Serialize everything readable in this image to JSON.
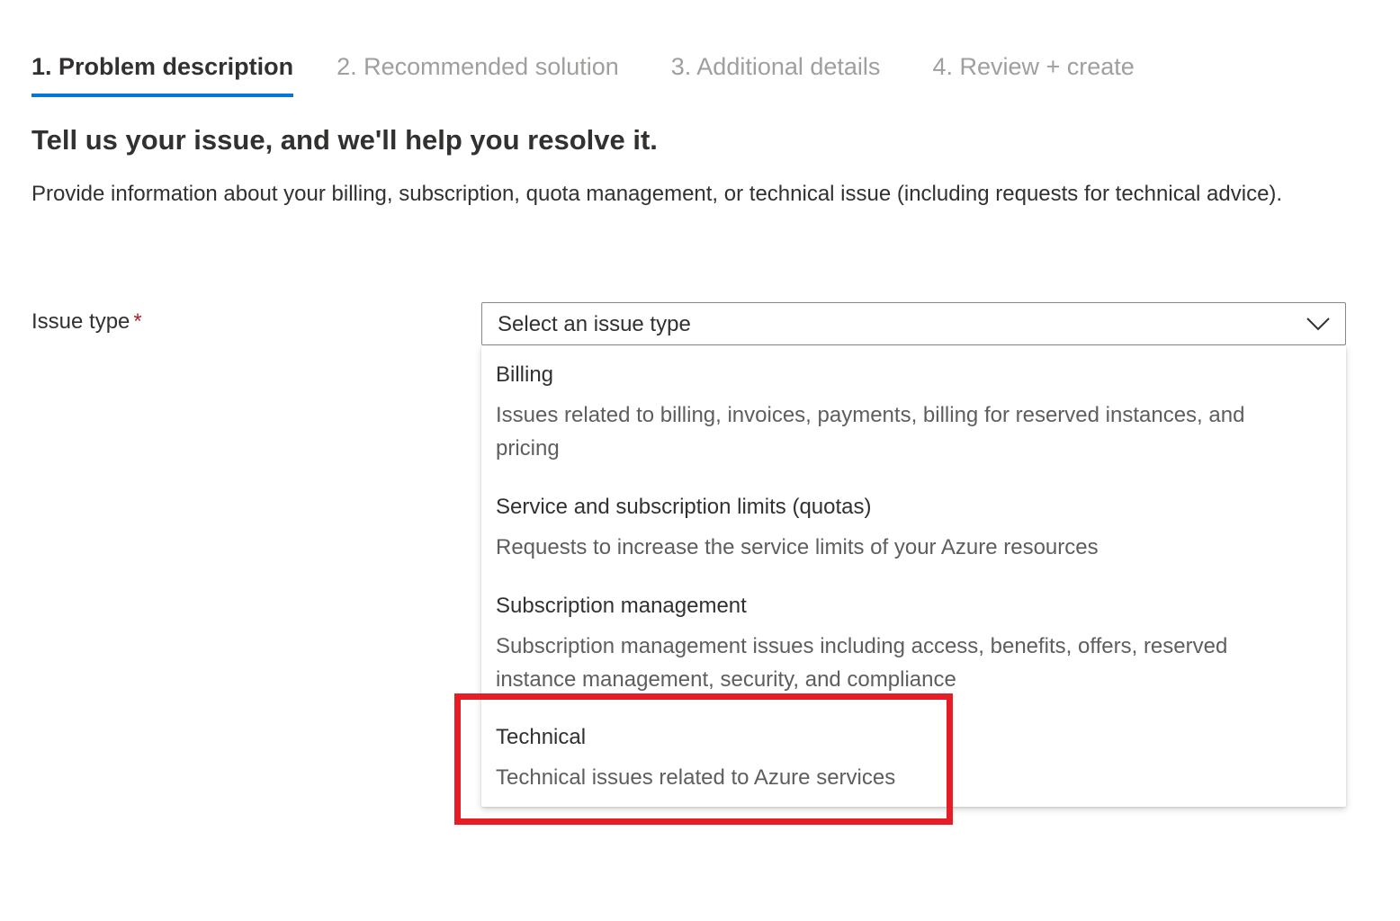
{
  "tabs": [
    {
      "label": "1. Problem description",
      "active": true
    },
    {
      "label": "2. Recommended solution",
      "active": false
    },
    {
      "label": "3. Additional details",
      "active": false
    },
    {
      "label": "4. Review + create",
      "active": false
    }
  ],
  "heading": "Tell us your issue, and we'll help you resolve it.",
  "description": "Provide information about your billing, subscription, quota management, or technical issue (including requests for technical advice).",
  "issue_type": {
    "label": "Issue type",
    "required_marker": "*",
    "placeholder": "Select an issue type",
    "options": [
      {
        "title": "Billing",
        "description": "Issues related to billing, invoices, payments, billing for reserved instances, and pricing"
      },
      {
        "title": "Service and subscription limits (quotas)",
        "description": "Requests to increase the service limits of your Azure resources"
      },
      {
        "title": "Subscription management",
        "description": "Subscription management issues including access, benefits, offers, reserved instance management, security, and compliance"
      },
      {
        "title": "Technical",
        "description": "Technical issues related to Azure services"
      }
    ]
  },
  "colors": {
    "accent": "#0078d4",
    "highlight": "#e81c24",
    "required": "#a4262c"
  },
  "icons": {
    "dropdown": "chevron-down-icon"
  }
}
